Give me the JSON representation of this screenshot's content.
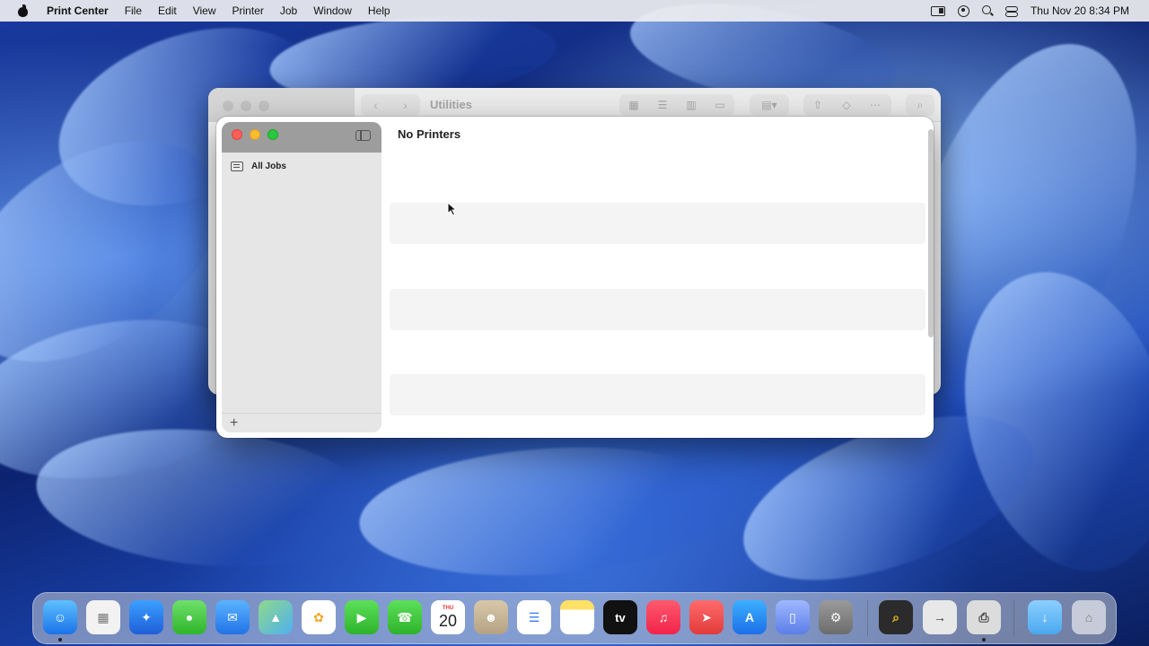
{
  "menubar": {
    "app_name": "Print Center",
    "menus": [
      "File",
      "Edit",
      "View",
      "Printer",
      "Job",
      "Window",
      "Help"
    ],
    "clock": "Thu Nov 20  8:34 PM",
    "status_icons": [
      "screen-mirroring-icon",
      "user-account-icon",
      "spotlight-search-icon",
      "control-center-icon"
    ]
  },
  "finder": {
    "title": "Utilities",
    "toolbar_icons": [
      "back-icon",
      "forward-icon",
      "icon-view-icon",
      "list-view-icon",
      "column-view-icon",
      "gallery-view-icon",
      "group-icon",
      "share-icon",
      "tag-icon",
      "more-icon",
      "search-icon"
    ]
  },
  "print_center": {
    "title": "No Printers",
    "sidebar": {
      "items": [
        {
          "label": "All Jobs",
          "icon": "jobs-list-icon"
        }
      ],
      "add_label": "+"
    }
  },
  "dock": {
    "calendar": {
      "month": "THU",
      "day": "20"
    },
    "tv_label": "tv",
    "apps": [
      "finder",
      "launchpad",
      "safari",
      "messages",
      "mail",
      "maps",
      "photos",
      "facetime",
      "phone",
      "calendar",
      "contacts",
      "reminders",
      "notes",
      "apple-tv",
      "music",
      "rocket",
      "app-store",
      "iphone-mirroring",
      "system-settings",
      "preview",
      "migration-assistant",
      "print-center",
      "downloads",
      "trash"
    ]
  }
}
